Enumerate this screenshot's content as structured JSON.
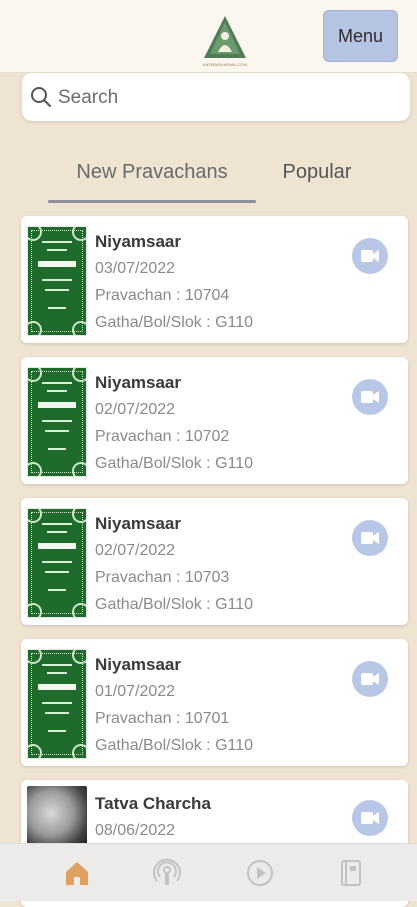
{
  "header": {
    "logo_text": "AATMADHARMA.COM",
    "menu_label": "Menu"
  },
  "search": {
    "placeholder": "Search"
  },
  "tabs": [
    {
      "label": "New Pravachans",
      "active": true
    },
    {
      "label": "Popular",
      "active": false
    }
  ],
  "items": [
    {
      "title": "Niyamsaar",
      "date": "03/07/2022",
      "pravachan": "Pravachan : 10704",
      "gatha": "Gatha/Bol/Slok : G110",
      "thumb": "book-cover"
    },
    {
      "title": "Niyamsaar",
      "date": "02/07/2022",
      "pravachan": "Pravachan : 10702",
      "gatha": "Gatha/Bol/Slok : G110",
      "thumb": "book-cover"
    },
    {
      "title": "Niyamsaar",
      "date": "02/07/2022",
      "pravachan": "Pravachan : 10703",
      "gatha": "Gatha/Bol/Slok : G110",
      "thumb": "book-cover"
    },
    {
      "title": "Niyamsaar",
      "date": "01/07/2022",
      "pravachan": "Pravachan : 10701",
      "gatha": "Gatha/Bol/Slok : G110",
      "thumb": "book-cover"
    },
    {
      "title": "Tatva Charcha",
      "date": "08/06/2022",
      "thumb": "speaker-photo"
    }
  ],
  "bottom_nav": [
    {
      "icon": "home-icon",
      "active": true
    },
    {
      "icon": "podcast-icon",
      "active": false
    },
    {
      "icon": "play-icon",
      "active": false
    },
    {
      "icon": "book-icon",
      "active": false
    }
  ],
  "colors": {
    "background": "#efe3d2",
    "accent_blue": "#b6c4e4",
    "active_nav": "#e0a062",
    "cover_green": "#1e6b2c"
  }
}
